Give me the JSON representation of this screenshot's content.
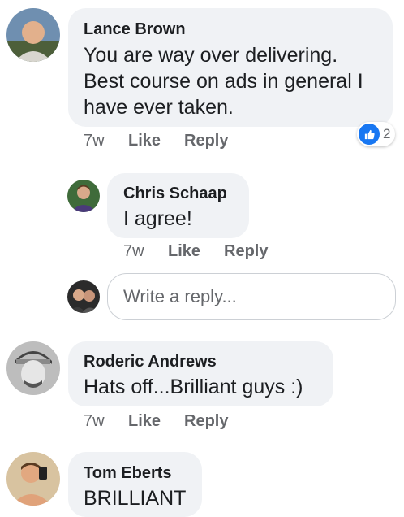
{
  "comments": [
    {
      "author": "Lance Brown",
      "lines": [
        "You are way over delivering.",
        "Best course on ads in general I",
        "have ever taken."
      ],
      "time": "7w",
      "like_label": "Like",
      "reply_label": "Reply",
      "reaction_count": "2",
      "reaction_icon": "thumbs-up-icon"
    },
    {
      "author": "Chris Schaap",
      "lines": [
        "I agree!"
      ],
      "time": "7w",
      "like_label": "Like",
      "reply_label": "Reply"
    },
    {
      "author": "Roderic Andrews",
      "lines": [
        "Hats off...Brilliant guys :)"
      ],
      "time": "7w",
      "like_label": "Like",
      "reply_label": "Reply"
    },
    {
      "author": "Tom Eberts",
      "lines": [
        "BRILLIANT"
      ]
    }
  ],
  "reply_box": {
    "placeholder": "Write a reply..."
  },
  "colors": {
    "bubble": "#f0f2f5",
    "like_blue": "#1877f2",
    "meta_gray": "#65676b"
  }
}
